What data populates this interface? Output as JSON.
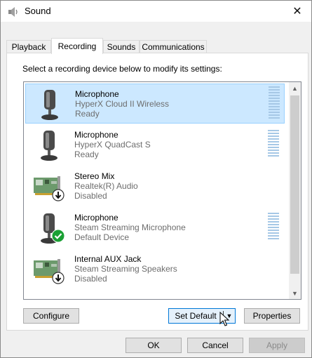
{
  "window": {
    "title": "Sound",
    "close_glyph": "✕"
  },
  "tabs": [
    {
      "label": "Playback"
    },
    {
      "label": "Recording"
    },
    {
      "label": "Sounds"
    },
    {
      "label": "Communications"
    }
  ],
  "recording": {
    "instruction": "Select a recording device below to modify its settings:",
    "devices": [
      {
        "name": "Microphone",
        "description": "HyperX Cloud II Wireless",
        "status": "Ready",
        "icon": "microphone-icon",
        "selected": true
      },
      {
        "name": "Microphone",
        "description": "HyperX QuadCast S",
        "status": "Ready",
        "icon": "microphone-icon",
        "selected": false
      },
      {
        "name": "Stereo Mix",
        "description": "Realtek(R) Audio",
        "status": "Disabled",
        "icon": "sound-card-icon",
        "badge": "disabled-arrow-badge",
        "selected": false
      },
      {
        "name": "Microphone",
        "description": "Steam Streaming Microphone",
        "status": "Default Device",
        "icon": "microphone-icon",
        "badge": "default-check-badge",
        "selected": false
      },
      {
        "name": "Internal AUX Jack",
        "description": "Steam Streaming Speakers",
        "status": "Disabled",
        "icon": "sound-card-icon",
        "badge": "disabled-arrow-badge",
        "selected": false
      }
    ],
    "buttons": {
      "configure": "Configure",
      "set_default": "Set Default",
      "properties": "Properties"
    }
  },
  "footer": {
    "ok": "OK",
    "cancel": "Cancel",
    "apply": "Apply"
  },
  "colors": {
    "selection": "#cce8ff",
    "selection_border": "#99d1ff",
    "meter": "#a6c8e6",
    "default_check": "#1aa034",
    "focus_border": "#0078d7"
  }
}
